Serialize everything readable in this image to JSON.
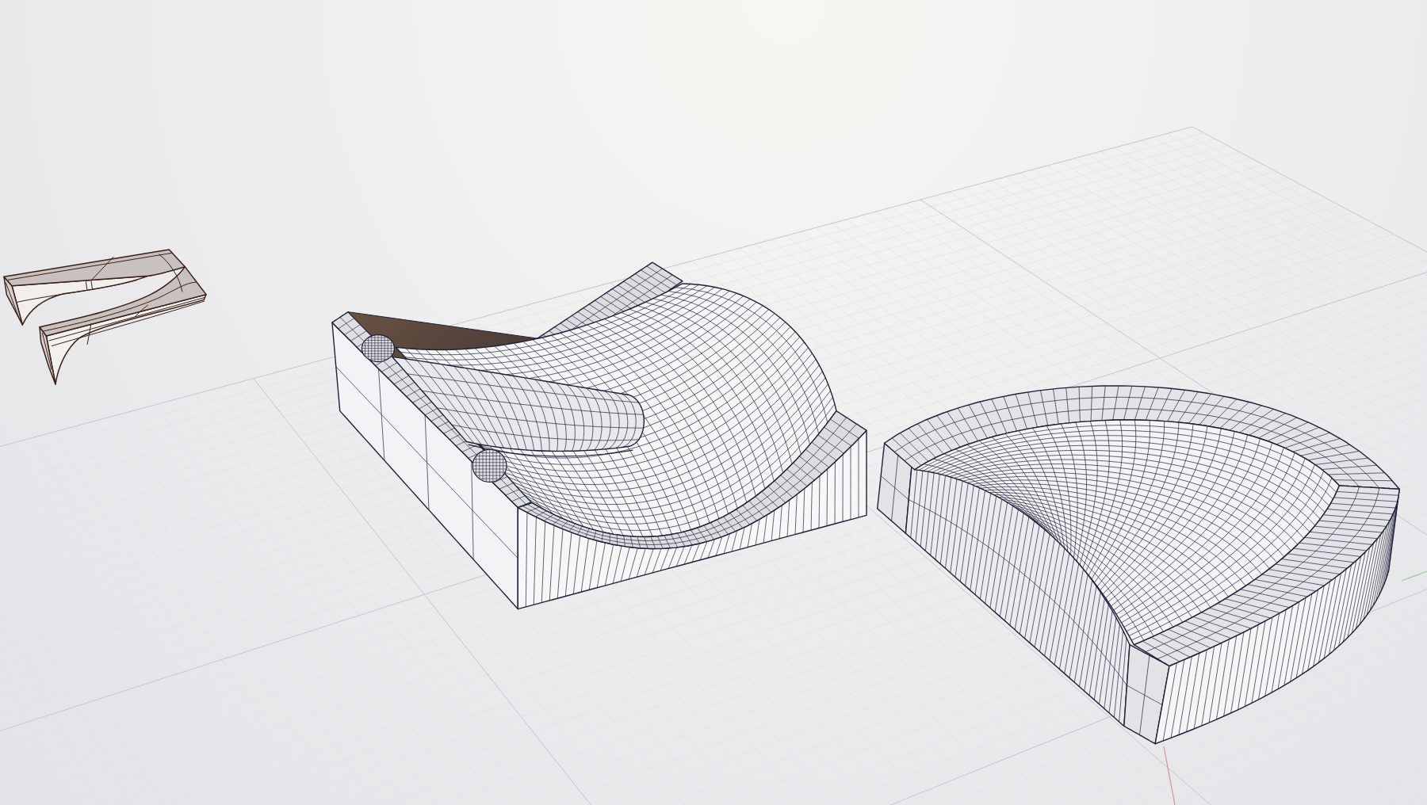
{
  "viewport": {
    "objects": [
      {
        "kind": "fork"
      },
      {
        "kind": "seat"
      },
      {
        "kind": "dome"
      }
    ]
  }
}
